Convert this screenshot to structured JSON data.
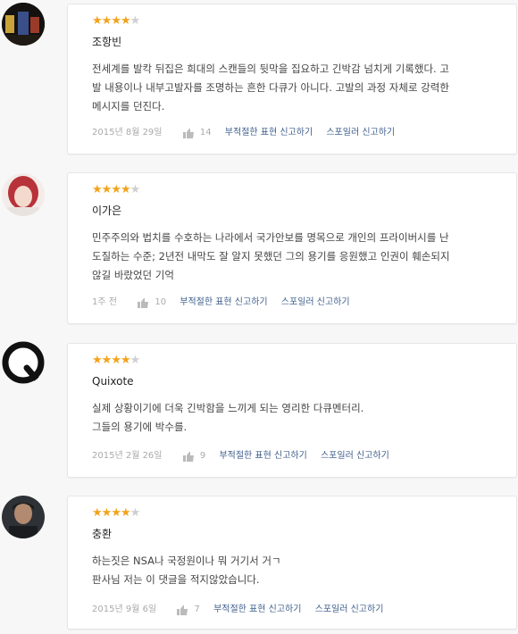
{
  "colors": {
    "star_on": "#f3a31b",
    "star_off": "#cfcfcf",
    "link": "#3e5e8c"
  },
  "reviews": [
    {
      "rating": 4,
      "name": "조항빈",
      "lines": [
        "전세계를 발칵 뒤집은 희대의 스캔들의 뒷막을 집요하고 긴박감 넘치게 기록했다. 고",
        "발 내용이나 내부고발자를 조명하는 흔한 다큐가 아니다. 고발의 과정 자체로 강력한",
        "메시지를 던진다."
      ],
      "date": "2015년 8월 29일",
      "likes": "14",
      "report_label": "부적절한 표현 신고하기",
      "spoiler_label": "스포일러 신고하기"
    },
    {
      "rating": 4,
      "name": "이가은",
      "lines": [
        "민주주의와 법치를 수호하는 나라에서 국가안보를 명목으로 개인의 프라이버시를 난",
        "도질하는 수준; 2년전 내막도 잘 알지 못했던 그의 용기를 응원했고 인권이 훼손되지",
        "않길 바랐었던 기억"
      ],
      "date": "1주 전",
      "likes": "10",
      "report_label": "부적절한 표현 신고하기",
      "spoiler_label": "스포일러 신고하기"
    },
    {
      "rating": 4,
      "name": "Quixote",
      "lines": [
        "실제 상황이기에 더욱 긴박함을 느끼게 되는 영리한 다큐멘터리.",
        "그들의 용기에 박수를."
      ],
      "date": "2015년 2월 26일",
      "likes": "9",
      "report_label": "부적절한 표현 신고하기",
      "spoiler_label": "스포일러 신고하기"
    },
    {
      "rating": 4,
      "name": "충환",
      "lines": [
        "하는짓은 NSA나 국정원이나 뭐 거기서 거ㄱ",
        "판사님 저는 이 댓글을 적지않았습니다."
      ],
      "date": "2015년 9월 6일",
      "likes": "7",
      "report_label": "부적절한 표현 신고하기",
      "spoiler_label": "스포일러 신고하기"
    }
  ]
}
